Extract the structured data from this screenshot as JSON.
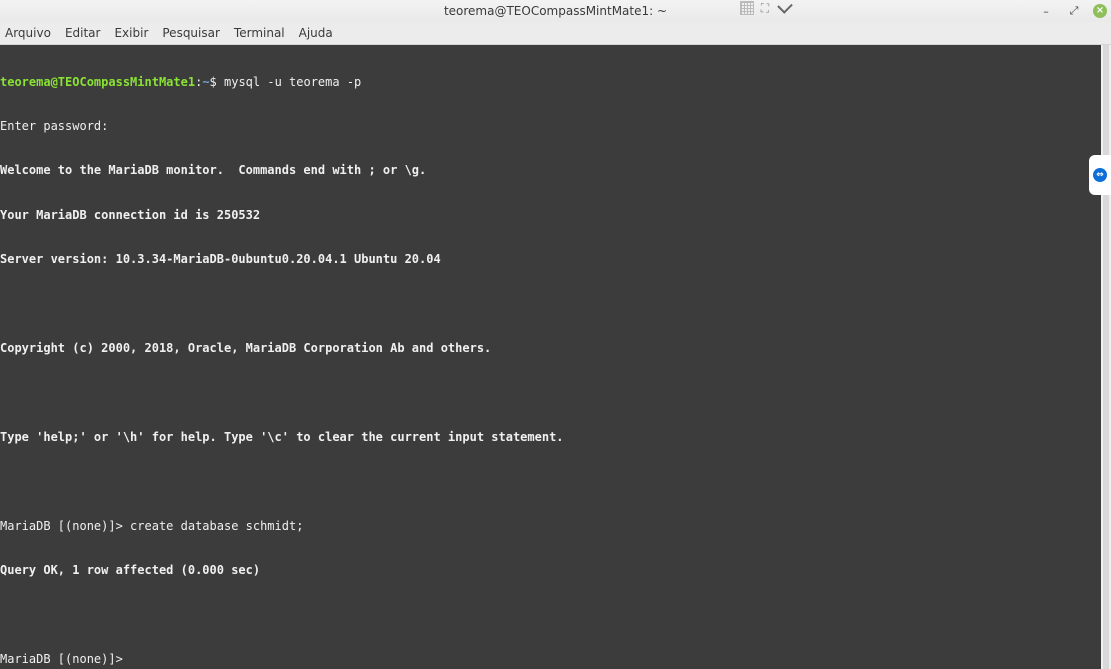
{
  "window": {
    "title": "teorema@TEOCompassMintMate1: ~",
    "minimize_glyph": "–",
    "maximize_glyph": "⤢",
    "close_glyph": "×"
  },
  "menubar": {
    "items": [
      {
        "label": "Arquivo"
      },
      {
        "label": "Editar"
      },
      {
        "label": "Exibir"
      },
      {
        "label": "Pesquisar"
      },
      {
        "label": "Terminal"
      },
      {
        "label": "Ajuda"
      }
    ]
  },
  "terminal": {
    "prompt": {
      "user_host": "teorema@TEOCompassMintMate1",
      "separator": ":",
      "path": "~",
      "symbol": "$ ",
      "command": "mysql -u teorema -p"
    },
    "lines": [
      {
        "text": "Enter password:",
        "bold": false
      },
      {
        "text": "Welcome to the MariaDB monitor.  Commands end with ; or \\g.",
        "bold": true
      },
      {
        "text": "Your MariaDB connection id is 250532",
        "bold": true
      },
      {
        "text": "Server version: 10.3.34-MariaDB-0ubuntu0.20.04.1 Ubuntu 20.04",
        "bold": true
      },
      {
        "text": "",
        "bold": false
      },
      {
        "text": "Copyright (c) 2000, 2018, Oracle, MariaDB Corporation Ab and others.",
        "bold": true
      },
      {
        "text": "",
        "bold": false
      },
      {
        "text": "Type 'help;' or '\\h' for help. Type '\\c' to clear the current input statement.",
        "bold": true
      },
      {
        "text": "",
        "bold": false
      },
      {
        "text": "MariaDB [(none)]> create database schmidt;",
        "bold": false
      },
      {
        "text": "Query OK, 1 row affected (0.000 sec)",
        "bold": true
      },
      {
        "text": "",
        "bold": false
      },
      {
        "text": "MariaDB [(none)]> ",
        "bold": false
      }
    ]
  },
  "colors": {
    "terminal_bg": "#3c3c3c",
    "prompt_user": "#8ae234",
    "prompt_path": "#729fcf",
    "close_button": "#8fbf5a",
    "teamviewer": "#0e6fd8"
  }
}
